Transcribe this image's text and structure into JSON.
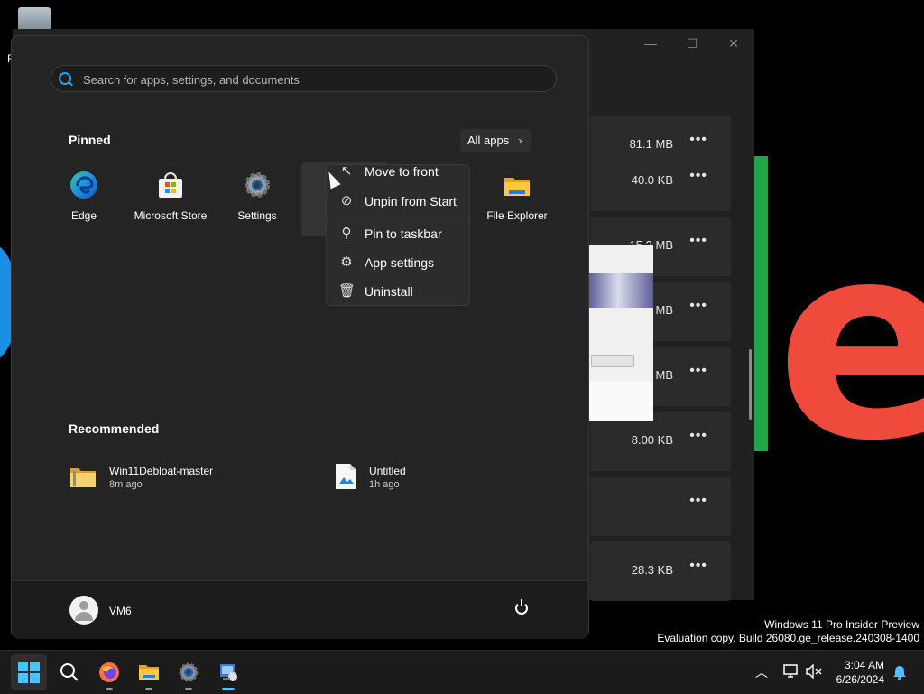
{
  "desktop": {
    "recycle_label": "R",
    "big_letter": "e"
  },
  "background_window": {
    "controls": {
      "minimize": "—",
      "maximize": "☐",
      "close": "✕"
    },
    "rows": [
      {
        "size": "81.1 MB"
      },
      {
        "size": "40.0 KB"
      },
      {
        "size": "15.2 MB"
      },
      {
        "size": "MB"
      },
      {
        "size": "MB"
      },
      {
        "size": "8.00 KB"
      },
      {
        "size": ""
      },
      {
        "size": "28.3 KB"
      }
    ],
    "more_label": "•••"
  },
  "start_menu": {
    "search_placeholder": "Search for apps, settings, and documents",
    "pinned_title": "Pinned",
    "all_apps_label": "All apps",
    "pinned": [
      {
        "label": "Edge",
        "icon": "edge-icon"
      },
      {
        "label": "Microsoft Store",
        "icon": "store-icon"
      },
      {
        "label": "Settings",
        "icon": "settings-icon"
      },
      {
        "label": "File Explorer",
        "icon": "folder-icon"
      }
    ],
    "recommended_title": "Recommended",
    "recommended": [
      {
        "name": "Win11Debloat-master",
        "time": "8m ago",
        "icon": "zip-folder-icon"
      },
      {
        "name": "Untitled",
        "time": "1h ago",
        "icon": "image-file-icon"
      }
    ],
    "user": {
      "name": "VM6"
    }
  },
  "context_menu": {
    "items": [
      {
        "label": "Move to front",
        "icon": "move-icon"
      },
      {
        "label": "Unpin from Start",
        "icon": "unpin-icon"
      },
      {
        "label": "Pin to taskbar",
        "icon": "pin-icon"
      },
      {
        "label": "App settings",
        "icon": "gear-icon"
      },
      {
        "label": "Uninstall",
        "icon": "trash-icon"
      }
    ]
  },
  "watermark": {
    "line1": "Windows 11 Pro Insider Preview",
    "line2": "Evaluation copy. Build 26080.ge_release.240308-1400"
  },
  "taskbar": {
    "time": "3:04 AM",
    "date": "6/26/2024",
    "colors": {
      "accent": "#4cc2ff"
    }
  }
}
